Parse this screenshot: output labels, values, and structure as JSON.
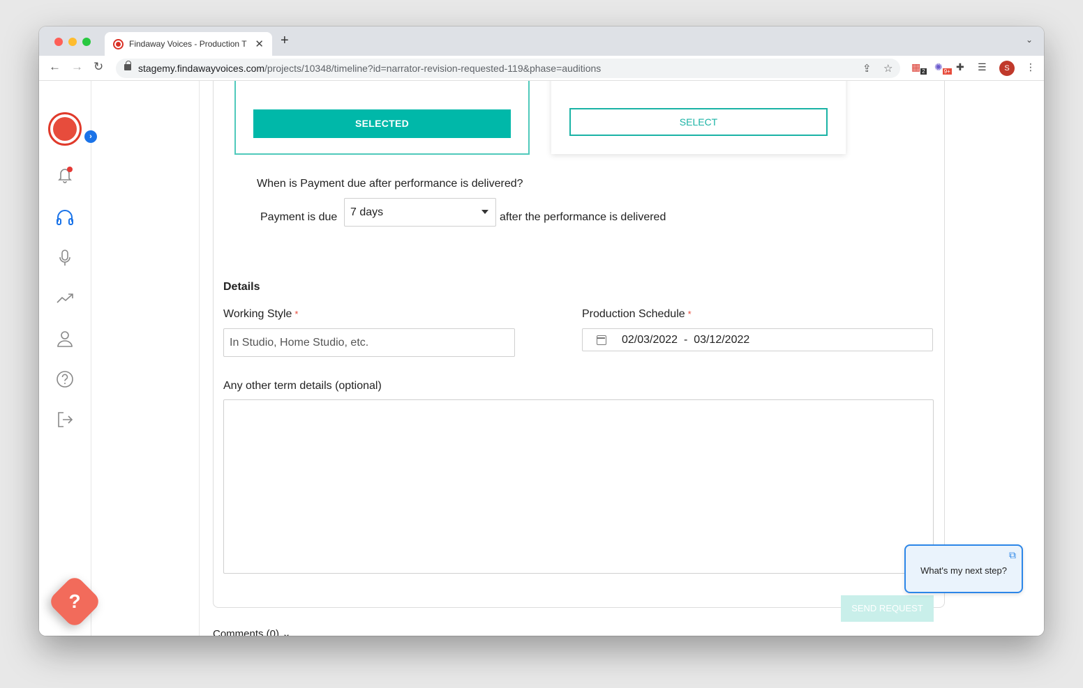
{
  "browser": {
    "tab_title": "Findaway Voices - Production T",
    "url_host": "stagemy.findawayvoices.com",
    "url_path": "/projects/10348/timeline?id=narrator-revision-requested-119&phase=auditions",
    "ext_badge_1": "2",
    "ext_badge_2": "9+",
    "profile_initial": "S"
  },
  "rail": {
    "icons": [
      "notification-bell-icon",
      "headphones-icon",
      "microphone-icon",
      "trending-up-icon",
      "user-icon",
      "help-circle-icon",
      "logout-icon"
    ]
  },
  "options": {
    "selected_label": "SELECTED",
    "select_label": "SELECT"
  },
  "payment": {
    "question": "When is Payment due after performance is delivered?",
    "prefix": "Payment is due",
    "selected_value": "7 days",
    "suffix": "after the performance is delivered"
  },
  "details": {
    "heading": "Details",
    "working_style_label": "Working Style",
    "working_style_placeholder": "In Studio, Home Studio, etc.",
    "schedule_label": "Production Schedule",
    "schedule_range": "02/03/2022  -  03/12/2022",
    "other_terms_label": "Any other term details (optional)",
    "required_mark": "*",
    "send_label": "SEND REQUEST"
  },
  "comments": {
    "label": "Comments (0)"
  },
  "help": {
    "next_step": "What's my next step?",
    "fab_glyph": "?"
  },
  "colors": {
    "accent_teal": "#00b8a9",
    "brand_red": "#e74c3c",
    "link_blue": "#2c86e8"
  }
}
